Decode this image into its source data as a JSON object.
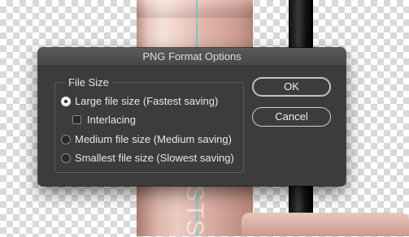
{
  "dialog": {
    "title": "PNG Format Options",
    "group_label": "File Size",
    "options": {
      "large": {
        "label": "Large file size (Fastest saving)",
        "selected": true
      },
      "interlacing": {
        "label": "Interlacing",
        "checked": false
      },
      "medium": {
        "label": "Medium file size (Medium saving)",
        "selected": false
      },
      "smallest": {
        "label": "Smallest file size (Slowest saving)",
        "selected": false
      }
    },
    "buttons": {
      "ok": "OK",
      "cancel": "Cancel"
    }
  },
  "canvas": {
    "artwork_text": "STS",
    "colors": {
      "tube_pink": "#e8c9c0",
      "guide_cyan": "#4fd0d3",
      "dialog_bg": "#3c3c3c"
    }
  }
}
